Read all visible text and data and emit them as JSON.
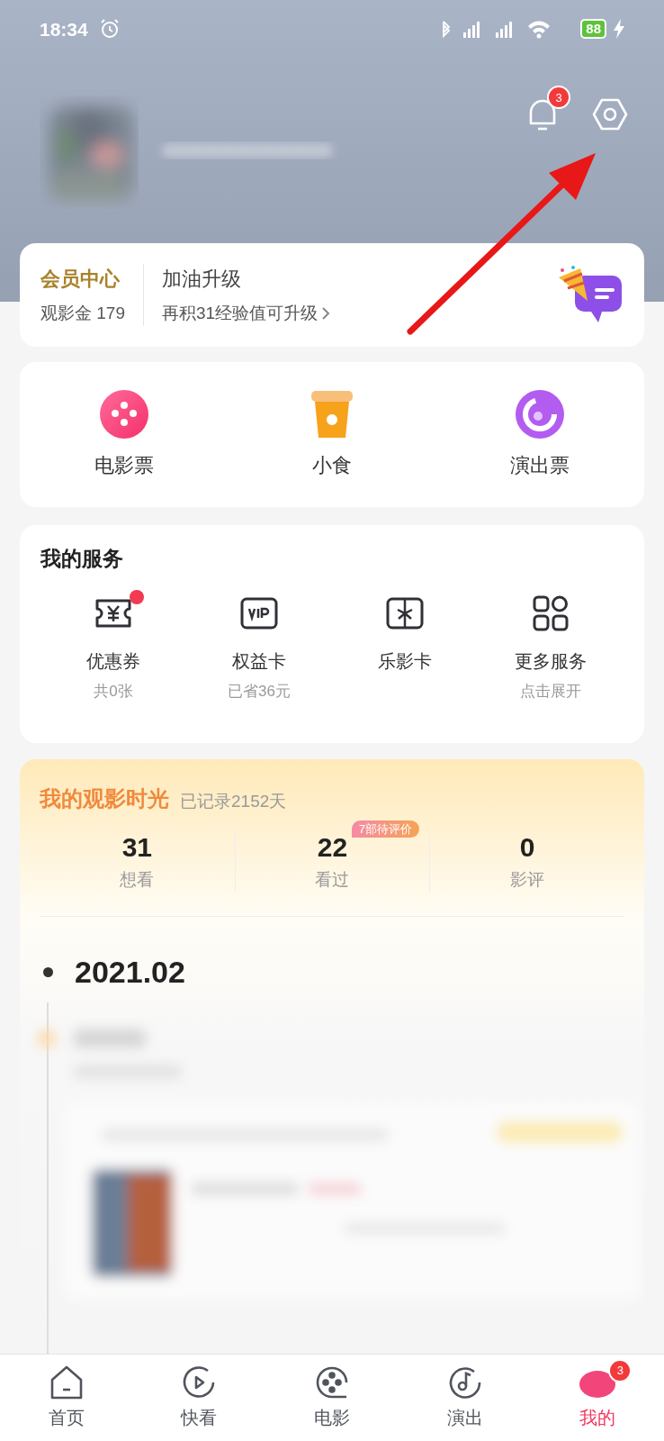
{
  "status_bar": {
    "time": "18:34",
    "battery": "88"
  },
  "header": {
    "notification_badge": "3"
  },
  "member": {
    "title": "会员中心",
    "coins": "观影金 179",
    "upgrade_title": "加油升级",
    "upgrade_hint": "再积31经验值可升级"
  },
  "tickets": [
    {
      "label": "电影票",
      "kind": "film"
    },
    {
      "label": "小食",
      "kind": "snack"
    },
    {
      "label": "演出票",
      "kind": "show"
    }
  ],
  "services": {
    "title": "我的服务",
    "items": [
      {
        "label": "优惠券",
        "sub": "共0张",
        "kind": "coupon",
        "dot": true
      },
      {
        "label": "权益卡",
        "sub": "已省36元",
        "kind": "vip",
        "dot": false
      },
      {
        "label": "乐影卡",
        "kind": "gift",
        "dot": false
      },
      {
        "label": "更多服务",
        "sub": "点击展开",
        "kind": "grid",
        "dot": false
      }
    ]
  },
  "film_time": {
    "title": "我的观影时光",
    "record": "已记录2152天",
    "stats": [
      {
        "value": "31",
        "label": "想看"
      },
      {
        "value": "22",
        "label": "看过",
        "tag": "7部待评价"
      },
      {
        "value": "0",
        "label": "影评"
      }
    ],
    "date": "2021.02"
  },
  "nav": [
    {
      "label": "首页",
      "kind": "home",
      "selected": false
    },
    {
      "label": "快看",
      "kind": "play",
      "selected": false
    },
    {
      "label": "电影",
      "kind": "film",
      "selected": false
    },
    {
      "label": "演出",
      "kind": "music",
      "selected": false
    },
    {
      "label": "我的",
      "kind": "me",
      "selected": true,
      "badge": "3"
    }
  ]
}
